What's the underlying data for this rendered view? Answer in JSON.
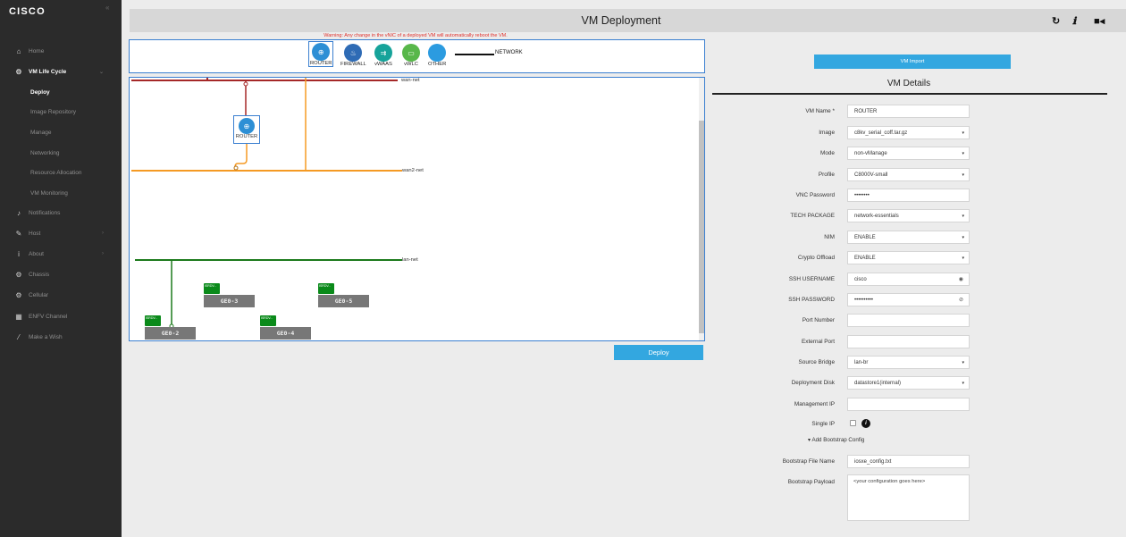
{
  "sidebar": {
    "logo": "CISCO",
    "collapse_icon": "«",
    "items": [
      {
        "label": "Home",
        "icon": "home-icon"
      },
      {
        "label": "VM Life Cycle",
        "icon": "gear-icon"
      },
      {
        "label": "Deploy"
      },
      {
        "label": "Image Repository"
      },
      {
        "label": "Manage"
      },
      {
        "label": "Networking"
      },
      {
        "label": "Resource Allocation"
      },
      {
        "label": "VM Monitoring"
      },
      {
        "label": "Notifications",
        "icon": "bell-icon"
      },
      {
        "label": "Host",
        "icon": "wrench-icon"
      },
      {
        "label": "About",
        "icon": "info-icon"
      },
      {
        "label": "Chassis",
        "icon": "gear-icon"
      },
      {
        "label": "Cellular",
        "icon": "gear-icon"
      },
      {
        "label": "ENFV Channel",
        "icon": "building-icon"
      },
      {
        "label": "Make a Wish",
        "icon": "magic-wand-icon"
      }
    ]
  },
  "header": {
    "title": "VM Deployment",
    "icons": [
      "refresh-icon",
      "info-icon",
      "video-icon"
    ]
  },
  "warning": "Warning: Any change in the vNIC of a deployed VM will automatically reboot the VM.",
  "palette": {
    "items": [
      {
        "label": "ROUTER",
        "color": "#2d8fd5"
      },
      {
        "label": "FIREWALL",
        "color": "#2e6bb5"
      },
      {
        "label": "vWAAS",
        "color": "#16a39a"
      },
      {
        "label": "vWLC",
        "color": "#58b74a"
      },
      {
        "label": "OTHER",
        "color": "#2b9be0"
      }
    ],
    "network_label": "NETWORK"
  },
  "topology": {
    "networks": [
      "wan-net",
      "wan2-net",
      "lan-net"
    ],
    "router_label": "ROUTER",
    "ports": [
      {
        "label": "GE0-2",
        "tab": "ISRDV..."
      },
      {
        "label": "GE0-3",
        "tab": "ISRDV..."
      },
      {
        "label": "GE0-4",
        "tab": "ISRDV..."
      },
      {
        "label": "GE0-5",
        "tab": "ISRDV..."
      }
    ],
    "colors": {
      "wan": "#a52828",
      "wan2": "#f59a23",
      "lan": "#1c7a1c"
    }
  },
  "deploy_button": "Deploy",
  "vm_import_button": "VM Import",
  "details": {
    "title": "VM Details",
    "fields": [
      {
        "label": "VM Name *",
        "value": "ROUTER"
      },
      {
        "label": "Image",
        "value": "c8kv_serial_coff.tar.gz"
      },
      {
        "label": "Mode",
        "value": "non-vManage"
      },
      {
        "label": "Profile",
        "value": "C8000V-small"
      },
      {
        "label": "VNC Password",
        "value": "••••••••"
      },
      {
        "label": "TECH PACKAGE",
        "value": "network-essentials"
      },
      {
        "label": "NIM",
        "value": "ENABLE"
      },
      {
        "label": "Crypto Offload",
        "value": "ENABLE"
      },
      {
        "label": "SSH USERNAME",
        "value": "cisco"
      },
      {
        "label": "SSH PASSWORD",
        "value": "••••••••••"
      },
      {
        "label": "Port Number",
        "value": ""
      },
      {
        "label": "External Port",
        "value": ""
      },
      {
        "label": "Source Bridge",
        "value": "lan-br"
      },
      {
        "label": "Deployment Disk",
        "value": "datastore1(internal)"
      },
      {
        "label": "Management IP",
        "value": ""
      },
      {
        "label": "Single IP"
      },
      {
        "label": "Bootstrap File Name",
        "value": "iosxe_config.txt"
      },
      {
        "label": "Bootstrap Payload",
        "value": "<your configuration goes here>"
      }
    ],
    "add_bootstrap": "▾ Add Bootstrap Config"
  }
}
